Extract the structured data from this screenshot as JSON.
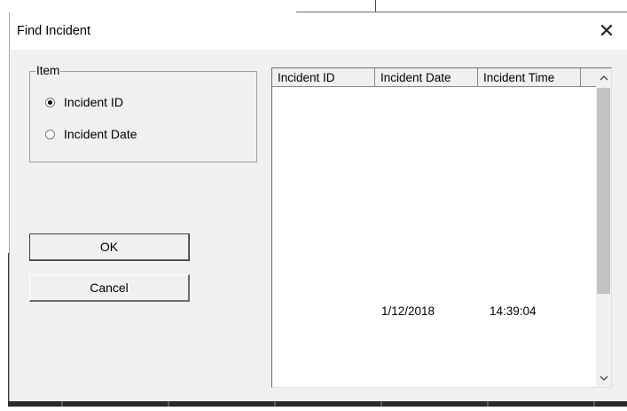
{
  "dialog": {
    "title": "Find Incident",
    "close_icon": "close-icon"
  },
  "item_group": {
    "legend": "Item",
    "options": [
      {
        "label": "Incident ID",
        "checked": true
      },
      {
        "label": "Incident Date",
        "checked": false
      }
    ]
  },
  "buttons": {
    "ok_label": "OK",
    "cancel_label": "Cancel"
  },
  "list": {
    "columns": [
      "Incident ID",
      "Incident Date",
      "Incident Time"
    ],
    "rows": [
      {
        "incident_id": "",
        "incident_date": "1/12/2018",
        "incident_time": "14:39:04"
      }
    ]
  },
  "scrollbar": {
    "up_icon": "chevron-up-icon",
    "down_icon": "chevron-down-icon"
  }
}
